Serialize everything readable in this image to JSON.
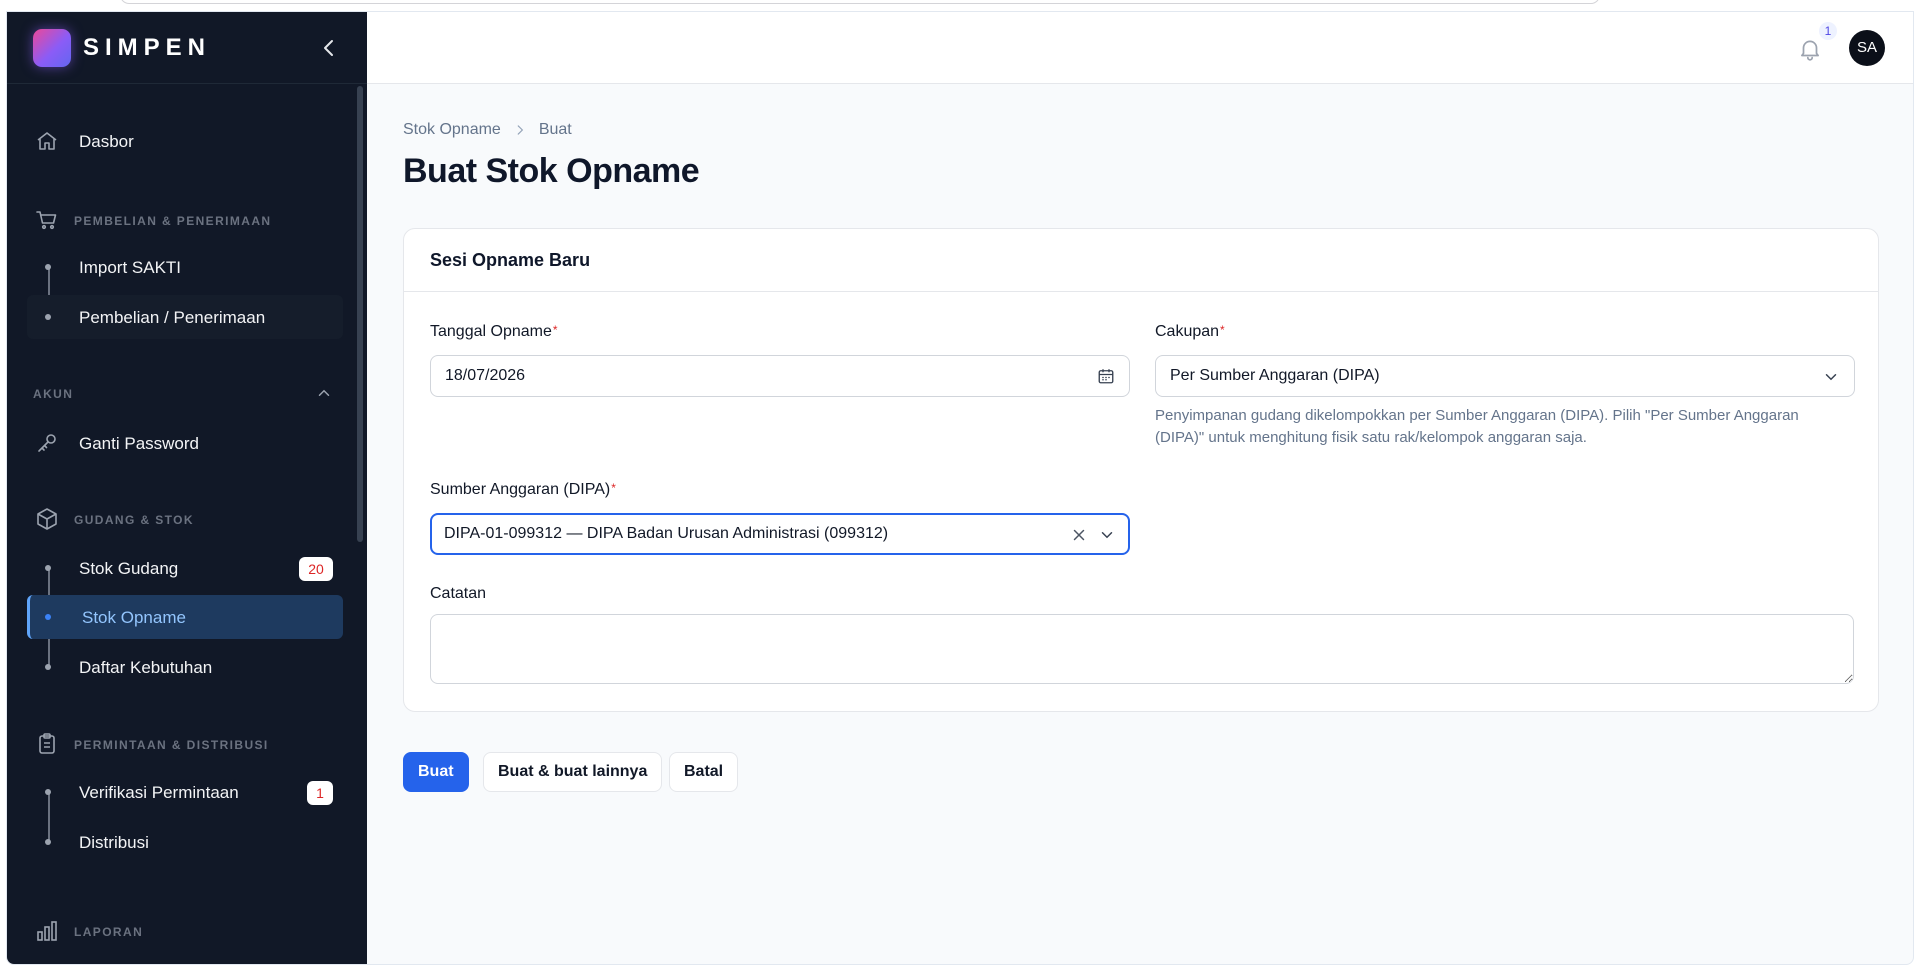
{
  "app": {
    "brand": "SIMPEN"
  },
  "sidebar": {
    "dashboard": "Dasbor",
    "group_purchase": "PEMBELIAN & PENERIMAAN",
    "import_sakti": "Import SAKTI",
    "purchase_receive": "Pembelian / Penerimaan",
    "group_account": "AKUN",
    "change_password": "Ganti Password",
    "group_warehouse": "GUDANG & STOK",
    "warehouse_stock": "Stok Gudang",
    "warehouse_stock_badge": "20",
    "stock_opname": "Stok Opname",
    "needs_list": "Daftar Kebutuhan",
    "group_request": "PERMINTAAN & DISTRIBUSI",
    "request_verification": "Verifikasi Permintaan",
    "request_verification_badge": "1",
    "distribution": "Distribusi",
    "group_report": "LAPORAN"
  },
  "topbar": {
    "notification_count": "1",
    "avatar_initials": "SA"
  },
  "breadcrumb": {
    "parent": "Stok Opname",
    "current": "Buat"
  },
  "page": {
    "title": "Buat Stok Opname"
  },
  "form": {
    "section_title": "Sesi Opname Baru",
    "date_label": "Tanggal Opname",
    "date_value": "18/07/2026",
    "scope_label": "Cakupan",
    "scope_value": "Per Sumber Anggaran (DIPA)",
    "scope_help": "Penyimpanan gudang dikelompokkan per Sumber Anggaran (DIPA). Pilih \"Per Sumber Anggaran (DIPA)\" untuk menghitung fisik satu rak/kelompok anggaran saja.",
    "source_label": "Sumber Anggaran (DIPA)",
    "source_value": "DIPA-01-099312 — DIPA Badan Urusan Administrasi (099312)",
    "notes_label": "Catatan",
    "notes_value": "",
    "required_mark": "*"
  },
  "actions": {
    "create": "Buat",
    "create_another": "Buat & buat lainnya",
    "cancel": "Batal"
  }
}
